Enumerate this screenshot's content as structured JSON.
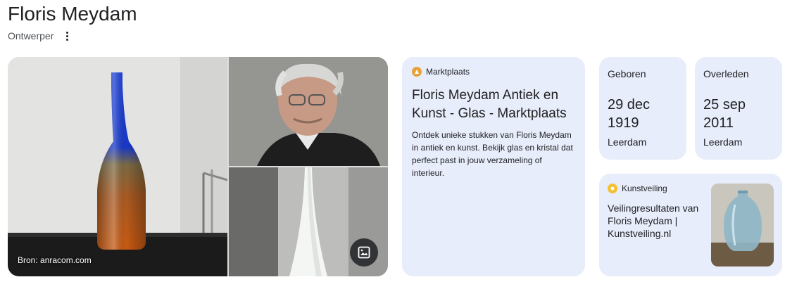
{
  "entity": {
    "name": "Floris Meydam",
    "type": "Ontwerper"
  },
  "images": {
    "source": "Bron: anracom.com"
  },
  "marktplaats": {
    "source": "Marktplaats",
    "title": "Floris Meydam Antiek en Kunst - Glas - Marktplaats",
    "description": "Ontdek unieke stukken van Floris Meydam in antiek en kunst. Bekijk glas en kristal dat perfect past in jouw verzameling of interieur."
  },
  "born": {
    "label": "Geboren",
    "date": "29 dec 1919",
    "place": "Leerdam"
  },
  "died": {
    "label": "Overleden",
    "date": "25 sep 2011",
    "place": "Leerdam"
  },
  "kunstveiling": {
    "source": "Kunstveiling",
    "title": "Veilingresultaten van Floris Meydam | Kunstveiling.nl"
  },
  "colors": {
    "card_bg": "#e8edfb",
    "title_text": "#202124",
    "marktplaats_icon": "#e8a23a",
    "kunstveiling_icon": "#f2c232"
  },
  "icons": [
    "more-vert-icon",
    "images-icon",
    "marktplaats-favicon",
    "kunstveiling-favicon"
  ]
}
